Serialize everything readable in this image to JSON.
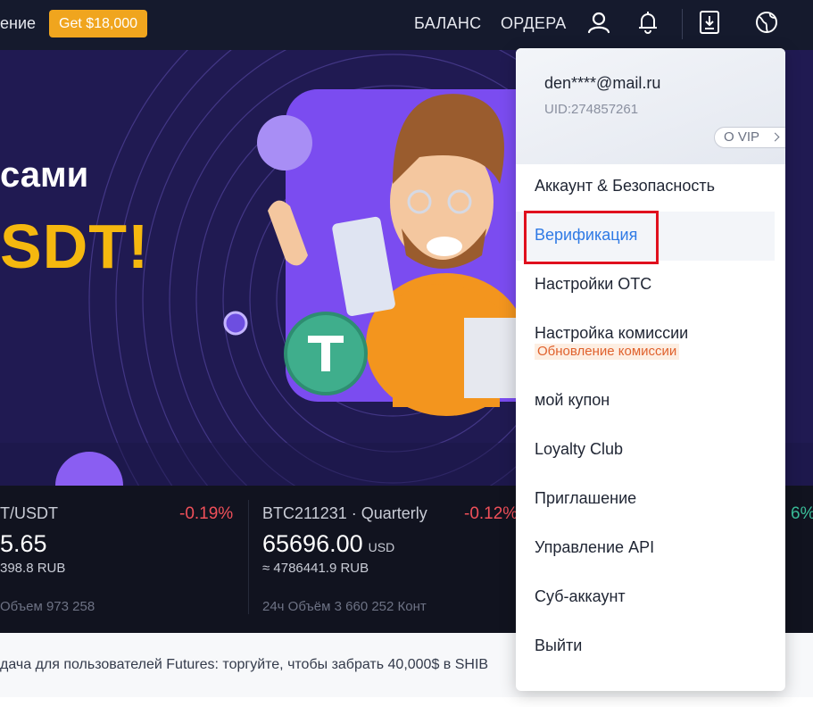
{
  "topbar": {
    "left_partial_text": "ение",
    "promo_label": "Get $18,000",
    "nav_balance": "БАЛАНС",
    "nav_orders": "ОРДЕРА",
    "icons": [
      "user-icon",
      "bell-icon",
      "download-icon",
      "globe-icon"
    ]
  },
  "hero": {
    "title_partial": "сами",
    "big_partial": "SDT!",
    "accent_color": "#f5b80f"
  },
  "tickers": [
    {
      "name": "T/USDT",
      "change": "-0.19%",
      "price": "5.65",
      "unit": "",
      "rub": "398.8 RUB",
      "volume": "Объем 973 258"
    },
    {
      "name": "BTC211231 · Quarterly",
      "change": "-0.12%",
      "price": "65696.00",
      "unit": "USD",
      "rub": "≈ 4786441.9 RUB",
      "volume": "24ч Объём 3 660 252 Конт"
    }
  ],
  "ticker_partial_right_change": "6%",
  "announcement": {
    "text": "дача для пользователей Futures: торгуйте, чтобы забрать 40,000$ в SHIB"
  },
  "dropdown": {
    "email": "den****@mail.ru",
    "uid": "UID:274857261",
    "vip_label": "O VIP",
    "items": [
      {
        "label": "Аккаунт & Безопасность"
      },
      {
        "label": "Верификация"
      },
      {
        "label": "Настройки OTC"
      },
      {
        "label": "Настройка комиссии",
        "badge": "Обновление комиссии"
      },
      {
        "label": "мой купон"
      },
      {
        "label": "Loyalty Club"
      },
      {
        "label": "Приглашение"
      },
      {
        "label": "Управление API"
      },
      {
        "label": "Суб-аккаунт"
      },
      {
        "label": "Выйти"
      }
    ]
  }
}
